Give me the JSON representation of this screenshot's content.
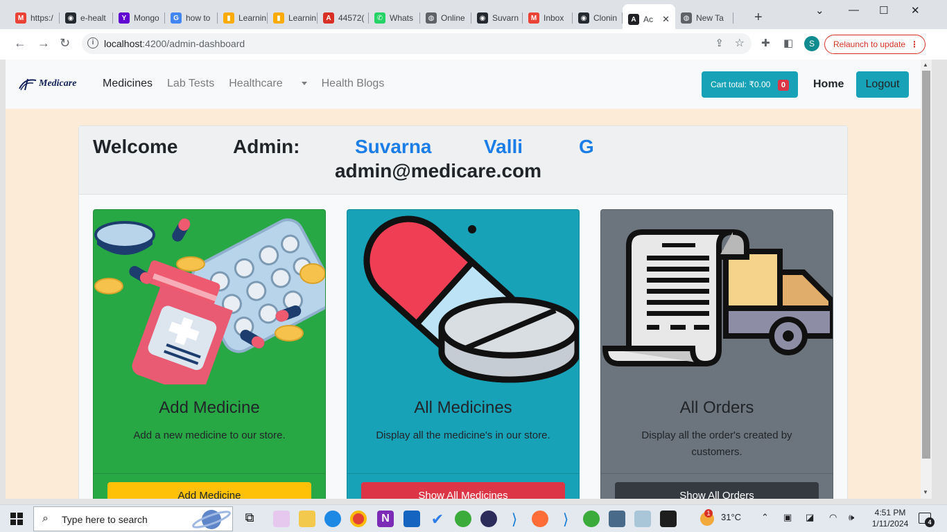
{
  "browser": {
    "tabs": [
      {
        "label": "https:/",
        "icon": "gmail-icon",
        "color": "#ea4335",
        "glyph": "M"
      },
      {
        "label": "e-healt",
        "icon": "github-icon",
        "color": "#24292f",
        "glyph": "◉"
      },
      {
        "label": "Mongo",
        "icon": "yahoo-icon",
        "color": "#6001d2",
        "glyph": "Y"
      },
      {
        "label": "how to",
        "icon": "google-icon",
        "color": "#4285f4",
        "glyph": "G"
      },
      {
        "label": "Learnin",
        "icon": "analytics-icon",
        "color": "#f9ab00",
        "glyph": "▮"
      },
      {
        "label": "Learnin",
        "icon": "analytics-icon",
        "color": "#f9ab00",
        "glyph": "▮"
      },
      {
        "label": "44572(",
        "icon": "pdf-icon",
        "color": "#d93025",
        "glyph": "A"
      },
      {
        "label": "Whats",
        "icon": "whatsapp-icon",
        "color": "#25d366",
        "glyph": "✆"
      },
      {
        "label": "Online",
        "icon": "globe-icon",
        "color": "#5f6368",
        "glyph": "◍"
      },
      {
        "label": "Suvarn",
        "icon": "github-icon",
        "color": "#24292f",
        "glyph": "◉"
      },
      {
        "label": "Inbox",
        "icon": "gmail-icon",
        "color": "#ea4335",
        "glyph": "M"
      },
      {
        "label": "Clonin",
        "icon": "github-icon",
        "color": "#24292f",
        "glyph": "◉"
      },
      {
        "label": "Ac",
        "icon": "angular-icon",
        "color": "#202124",
        "glyph": "A",
        "active": true
      },
      {
        "label": "New Ta",
        "icon": "globe-icon",
        "color": "#5f6368",
        "glyph": "◍"
      }
    ],
    "url_host": "localhost",
    "url_path": ":4200/admin-dashboard",
    "profile_initial": "S",
    "relaunch_label": "Relaunch to update"
  },
  "navbar": {
    "brand": "Medicare",
    "links": [
      {
        "label": "Medicines",
        "active": true
      },
      {
        "label": "Lab Tests",
        "active": false
      },
      {
        "label": "Healthcare",
        "active": false,
        "dropdown": true
      },
      {
        "label": "Health Blogs",
        "active": false
      }
    ],
    "cart_label": "Cart total: ₹0.00",
    "cart_count": "0",
    "home_label": "Home",
    "logout_label": "Logout"
  },
  "dashboard": {
    "welcome_word": "Welcome",
    "admin_label": "Admin:",
    "first_name": "Suvarna",
    "middle_name": "Valli",
    "last_initial": "G",
    "email": "admin@medicare.com",
    "cards": [
      {
        "title": "Add Medicine",
        "description": "Add a new medicine to our store.",
        "button": "Add Medicine",
        "bg": "#28a745",
        "btn_bg": "#ffc107",
        "btn_fg": "#212529"
      },
      {
        "title": "All Medicines",
        "description": "Display all the medicine's in our store.",
        "button": "Show All Medicines",
        "bg": "#17a2b8",
        "btn_bg": "#dc3545",
        "btn_fg": "#ffffff"
      },
      {
        "title": "All Orders",
        "description": "Display all the order's created by customers.",
        "button": "Show All Orders",
        "bg": "#6c757d",
        "btn_bg": "#343a40",
        "btn_fg": "#ffffff"
      }
    ]
  },
  "taskbar": {
    "search_placeholder": "Type here to search",
    "weather": "31°C",
    "weather_badge": "1",
    "time": "4:51 PM",
    "date": "1/11/2024",
    "notification_count": "4"
  }
}
